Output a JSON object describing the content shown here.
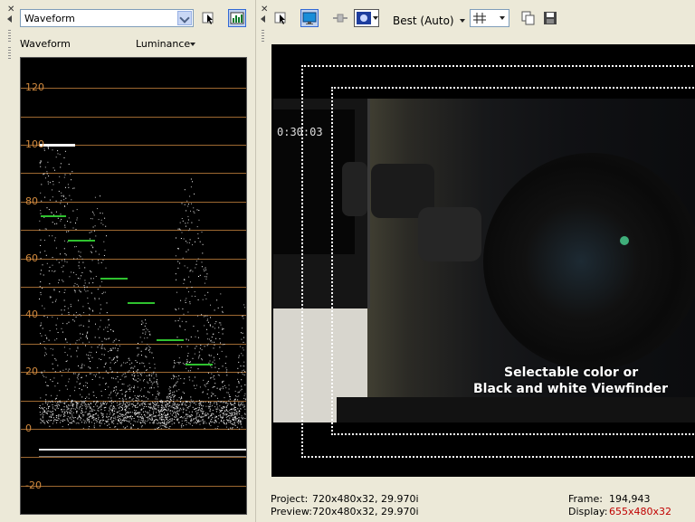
{
  "left_panel": {
    "scope_select_value": "Waveform",
    "scope_title": "Waveform",
    "luminance_label": "Luminance",
    "scale_labels": [
      "120",
      "100",
      "80",
      "60",
      "40",
      "20",
      "0",
      "-20"
    ]
  },
  "right_panel": {
    "quality_label": "Best (Auto)",
    "video_timecode": "0:30:03",
    "overlay_lines": [
      "Selectable color or",
      "Black and white Viewfinder"
    ],
    "status": {
      "project_label": "Project:",
      "project_value": "720x480x32, 29.970i",
      "preview_label": "Preview:",
      "preview_value": "720x480x32, 29.970i",
      "frame_label": "Frame:",
      "frame_value": "194,943",
      "display_label": "Display:",
      "display_value": "655x480x32"
    }
  },
  "colors": {
    "grid_orange": "#d28a3e",
    "marker_green": "#2fc22f",
    "display_red": "#c00000",
    "panel_bg": "#ece9d8"
  }
}
